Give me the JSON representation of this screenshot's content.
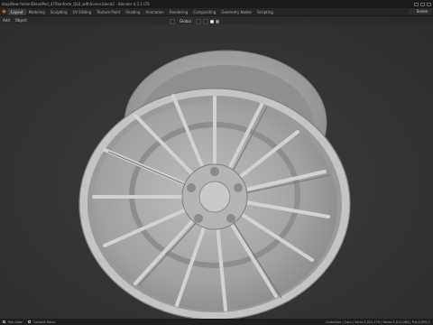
{
  "app": {
    "title": "ktop\\New folder\\BlendPod_47\\Ronforte_QL0_withScene.blend2 - Blender 4.2.1 LTS"
  },
  "workspace_tabs": [
    {
      "label": "Layout",
      "active": true
    },
    {
      "label": "Modeling",
      "active": false
    },
    {
      "label": "Sculpting",
      "active": false
    },
    {
      "label": "UV Editing",
      "active": false
    },
    {
      "label": "Texture Paint",
      "active": false
    },
    {
      "label": "Shading",
      "active": false
    },
    {
      "label": "Animation",
      "active": false
    },
    {
      "label": "Rendering",
      "active": false
    },
    {
      "label": "Compositing",
      "active": false
    },
    {
      "label": "Geometry Nodes",
      "active": false
    },
    {
      "label": "Scripting",
      "active": false
    }
  ],
  "scene": {
    "label": "Scene"
  },
  "viewport_header": {
    "menus": [
      "Add",
      "Object"
    ],
    "transform_orientation": "Global"
  },
  "statusbar": {
    "left": [
      "Pan View",
      "Context Menu"
    ],
    "right": "Collection | Cam | Verts:3,021,175 | Faces:3,011,084 | Tris:2,955,1"
  },
  "colors": {
    "background": "#373737",
    "wheel_fill": "#a8a8a8",
    "accent": "#e08a28"
  }
}
